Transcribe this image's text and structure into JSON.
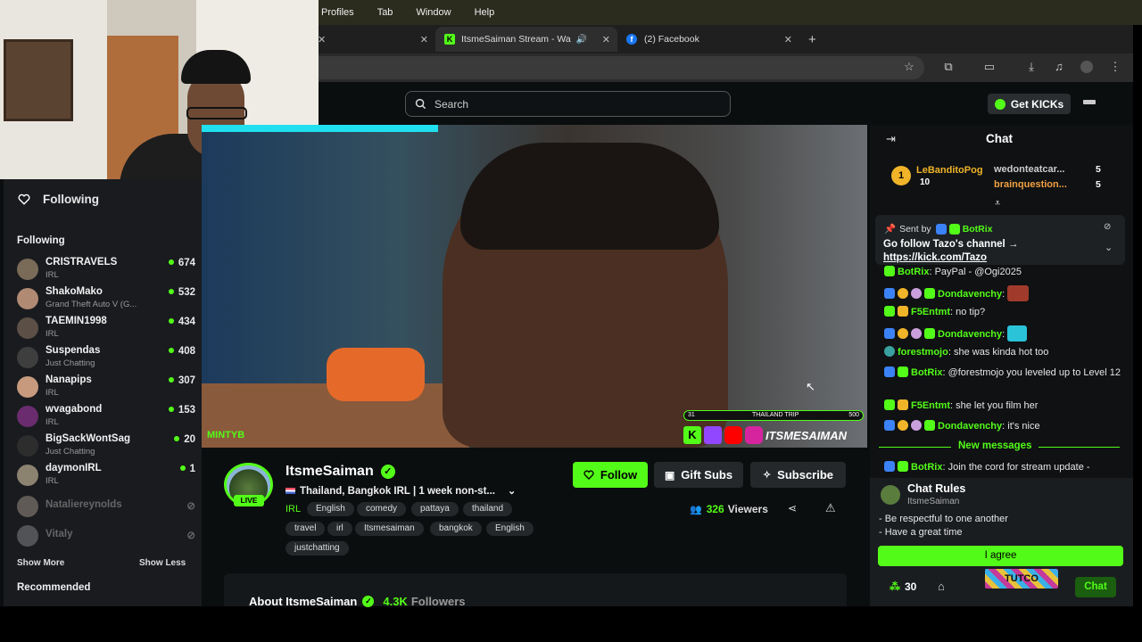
{
  "menubar": {
    "items": [
      "Profiles",
      "Tab",
      "Window",
      "Help"
    ]
  },
  "browser": {
    "tabs": [
      {
        "label": "ItsmeSaiman Stream - Wa",
        "active": true
      },
      {
        "label": "(2) Facebook",
        "active": false
      }
    ],
    "new_tab": "+",
    "close_glyph": "✕"
  },
  "header": {
    "search_placeholder": "Search",
    "get_kicks": "Get KICKs"
  },
  "sidebar": {
    "title": "Following",
    "section_following": "Following",
    "channels": [
      {
        "name": "CRISTRAVELS",
        "category": "IRL",
        "viewers": "674",
        "live": true
      },
      {
        "name": "ShakoMako",
        "category": "Grand Theft Auto V (G...",
        "viewers": "532",
        "live": true
      },
      {
        "name": "TAEMIN1998",
        "category": "IRL",
        "viewers": "434",
        "live": true
      },
      {
        "name": "Suspendas",
        "category": "Just Chatting",
        "viewers": "408",
        "live": true
      },
      {
        "name": "Nanapips",
        "category": "IRL",
        "viewers": "307",
        "live": true
      },
      {
        "name": "wvagabond",
        "category": "IRL",
        "viewers": "153",
        "live": true
      },
      {
        "name": "BigSackWontSag",
        "category": "Just Chatting",
        "viewers": "20",
        "live": true
      },
      {
        "name": "daymonIRL",
        "category": "IRL",
        "viewers": "1",
        "live": true
      },
      {
        "name": "Nataliereynolds",
        "category": "",
        "viewers": "",
        "live": false
      },
      {
        "name": "Vitaly",
        "category": "",
        "viewers": "",
        "live": false
      }
    ],
    "show_more": "Show More",
    "show_less": "Show Less",
    "recommended": "Recommended"
  },
  "video": {
    "overlay_handle": "MINTYB",
    "progress_start": "31",
    "progress_label": "THAILAND TRIP",
    "progress_end": "500",
    "brand_handle": "ITSMESAIMAN"
  },
  "stream": {
    "live_badge": "LIVE",
    "streamer": "ItsmeSaiman",
    "title": "Thailand, Bangkok IRL | 1 week non-st...",
    "category": "IRL",
    "tags": [
      "English",
      "comedy",
      "pattaya",
      "thailand",
      "travel",
      "irl",
      "Itsmesaiman",
      "bangkok",
      "English",
      "justchatting"
    ],
    "follow_label": "Follow",
    "gift_label": "Gift Subs",
    "subscribe_label": "Subscribe",
    "viewers_count": "326",
    "viewers_label": "Viewers",
    "about_prefix": "About ItsmeSaiman",
    "followers_count": "4.3K",
    "followers_label": "Followers"
  },
  "chat": {
    "title": "Chat",
    "gifters": [
      {
        "rank": "1",
        "name": "LeBanditoPog",
        "count": "10"
      },
      {
        "name": "wedonteatcar...",
        "count": "5"
      },
      {
        "name": "brainquestion...",
        "count": "5"
      }
    ],
    "pinned": {
      "sent_by": "Sent by",
      "sender": "BotRix",
      "text": "Go follow Tazo's channel →",
      "link": "https://kick.com/Tazo"
    },
    "messages": [
      {
        "user": "BotRix",
        "text": "PayPal - @Ogi2025"
      },
      {
        "user": "Dondavenchy",
        "text": ""
      },
      {
        "user": "F5Entmt",
        "text": "no tip?"
      },
      {
        "user": "Dondavenchy",
        "text": ""
      },
      {
        "user": "forestmojo",
        "text": "she was kinda hot too"
      },
      {
        "user": "BotRix",
        "text": "@forestmojo you leveled up to Level 12"
      },
      {
        "user": "F5Entmt",
        "text": "she let you film her"
      },
      {
        "user": "Dondavenchy",
        "text": "it's nice"
      },
      {
        "user": "BotRix",
        "text": "Join the cord for stream update -"
      }
    ],
    "new_messages": "New messages",
    "rules": {
      "title": "Chat Rules",
      "owner": "ItsmeSaiman",
      "lines": [
        "- Be respectful to one another",
        "- Have a great time"
      ],
      "agree": "I agree"
    },
    "points": "30",
    "emote_label": "TUTCO",
    "chat_button": "Chat"
  },
  "colors": {
    "accent": "#53fc18",
    "bg": "#0b0e0f"
  }
}
